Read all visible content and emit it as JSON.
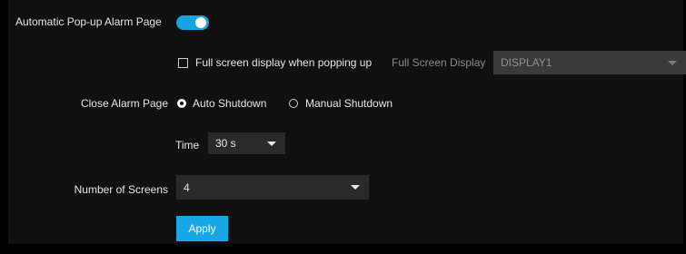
{
  "popup": {
    "label": "Automatic Pop-up Alarm Page",
    "enabled": true
  },
  "fullscreen": {
    "checkbox_label": "Full screen display when popping up",
    "checked": false,
    "display_label": "Full Screen Display",
    "display_value": "DISPLAY1"
  },
  "close_alarm": {
    "label": "Close Alarm Page",
    "options": [
      "Auto Shutdown",
      "Manual Shutdown"
    ],
    "selected": "Auto Shutdown"
  },
  "time": {
    "label": "Time",
    "value": "30 s"
  },
  "screens": {
    "label": "Number of Screens",
    "value": "4"
  },
  "apply_label": "Apply",
  "colors": {
    "accent": "#16a3e4",
    "background": "#101010"
  }
}
